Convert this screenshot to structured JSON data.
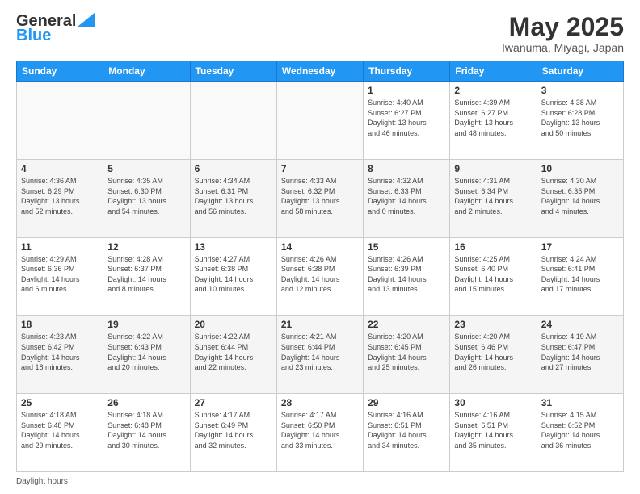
{
  "header": {
    "logo_line1": "General",
    "logo_line2": "Blue",
    "title": "May 2025",
    "subtitle": "Iwanuma, Miyagi, Japan"
  },
  "footer": {
    "daylight_label": "Daylight hours"
  },
  "days_of_week": [
    "Sunday",
    "Monday",
    "Tuesday",
    "Wednesday",
    "Thursday",
    "Friday",
    "Saturday"
  ],
  "weeks": [
    [
      {
        "day": "",
        "info": ""
      },
      {
        "day": "",
        "info": ""
      },
      {
        "day": "",
        "info": ""
      },
      {
        "day": "",
        "info": ""
      },
      {
        "day": "1",
        "info": "Sunrise: 4:40 AM\nSunset: 6:27 PM\nDaylight: 13 hours\nand 46 minutes."
      },
      {
        "day": "2",
        "info": "Sunrise: 4:39 AM\nSunset: 6:27 PM\nDaylight: 13 hours\nand 48 minutes."
      },
      {
        "day": "3",
        "info": "Sunrise: 4:38 AM\nSunset: 6:28 PM\nDaylight: 13 hours\nand 50 minutes."
      }
    ],
    [
      {
        "day": "4",
        "info": "Sunrise: 4:36 AM\nSunset: 6:29 PM\nDaylight: 13 hours\nand 52 minutes."
      },
      {
        "day": "5",
        "info": "Sunrise: 4:35 AM\nSunset: 6:30 PM\nDaylight: 13 hours\nand 54 minutes."
      },
      {
        "day": "6",
        "info": "Sunrise: 4:34 AM\nSunset: 6:31 PM\nDaylight: 13 hours\nand 56 minutes."
      },
      {
        "day": "7",
        "info": "Sunrise: 4:33 AM\nSunset: 6:32 PM\nDaylight: 13 hours\nand 58 minutes."
      },
      {
        "day": "8",
        "info": "Sunrise: 4:32 AM\nSunset: 6:33 PM\nDaylight: 14 hours\nand 0 minutes."
      },
      {
        "day": "9",
        "info": "Sunrise: 4:31 AM\nSunset: 6:34 PM\nDaylight: 14 hours\nand 2 minutes."
      },
      {
        "day": "10",
        "info": "Sunrise: 4:30 AM\nSunset: 6:35 PM\nDaylight: 14 hours\nand 4 minutes."
      }
    ],
    [
      {
        "day": "11",
        "info": "Sunrise: 4:29 AM\nSunset: 6:36 PM\nDaylight: 14 hours\nand 6 minutes."
      },
      {
        "day": "12",
        "info": "Sunrise: 4:28 AM\nSunset: 6:37 PM\nDaylight: 14 hours\nand 8 minutes."
      },
      {
        "day": "13",
        "info": "Sunrise: 4:27 AM\nSunset: 6:38 PM\nDaylight: 14 hours\nand 10 minutes."
      },
      {
        "day": "14",
        "info": "Sunrise: 4:26 AM\nSunset: 6:38 PM\nDaylight: 14 hours\nand 12 minutes."
      },
      {
        "day": "15",
        "info": "Sunrise: 4:26 AM\nSunset: 6:39 PM\nDaylight: 14 hours\nand 13 minutes."
      },
      {
        "day": "16",
        "info": "Sunrise: 4:25 AM\nSunset: 6:40 PM\nDaylight: 14 hours\nand 15 minutes."
      },
      {
        "day": "17",
        "info": "Sunrise: 4:24 AM\nSunset: 6:41 PM\nDaylight: 14 hours\nand 17 minutes."
      }
    ],
    [
      {
        "day": "18",
        "info": "Sunrise: 4:23 AM\nSunset: 6:42 PM\nDaylight: 14 hours\nand 18 minutes."
      },
      {
        "day": "19",
        "info": "Sunrise: 4:22 AM\nSunset: 6:43 PM\nDaylight: 14 hours\nand 20 minutes."
      },
      {
        "day": "20",
        "info": "Sunrise: 4:22 AM\nSunset: 6:44 PM\nDaylight: 14 hours\nand 22 minutes."
      },
      {
        "day": "21",
        "info": "Sunrise: 4:21 AM\nSunset: 6:44 PM\nDaylight: 14 hours\nand 23 minutes."
      },
      {
        "day": "22",
        "info": "Sunrise: 4:20 AM\nSunset: 6:45 PM\nDaylight: 14 hours\nand 25 minutes."
      },
      {
        "day": "23",
        "info": "Sunrise: 4:20 AM\nSunset: 6:46 PM\nDaylight: 14 hours\nand 26 minutes."
      },
      {
        "day": "24",
        "info": "Sunrise: 4:19 AM\nSunset: 6:47 PM\nDaylight: 14 hours\nand 27 minutes."
      }
    ],
    [
      {
        "day": "25",
        "info": "Sunrise: 4:18 AM\nSunset: 6:48 PM\nDaylight: 14 hours\nand 29 minutes."
      },
      {
        "day": "26",
        "info": "Sunrise: 4:18 AM\nSunset: 6:48 PM\nDaylight: 14 hours\nand 30 minutes."
      },
      {
        "day": "27",
        "info": "Sunrise: 4:17 AM\nSunset: 6:49 PM\nDaylight: 14 hours\nand 32 minutes."
      },
      {
        "day": "28",
        "info": "Sunrise: 4:17 AM\nSunset: 6:50 PM\nDaylight: 14 hours\nand 33 minutes."
      },
      {
        "day": "29",
        "info": "Sunrise: 4:16 AM\nSunset: 6:51 PM\nDaylight: 14 hours\nand 34 minutes."
      },
      {
        "day": "30",
        "info": "Sunrise: 4:16 AM\nSunset: 6:51 PM\nDaylight: 14 hours\nand 35 minutes."
      },
      {
        "day": "31",
        "info": "Sunrise: 4:15 AM\nSunset: 6:52 PM\nDaylight: 14 hours\nand 36 minutes."
      }
    ]
  ]
}
